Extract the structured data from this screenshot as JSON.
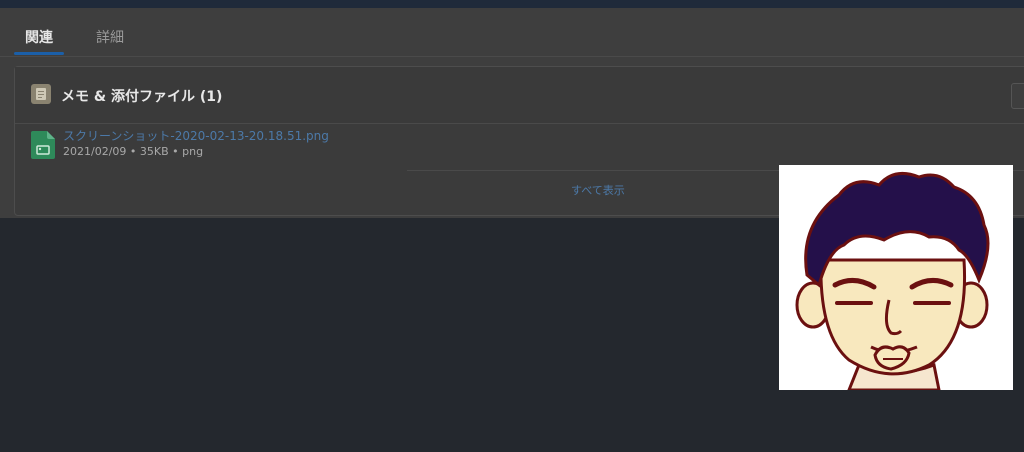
{
  "tabs": [
    {
      "label": "関連",
      "active": true
    },
    {
      "label": "詳細",
      "active": false
    }
  ],
  "related_list": {
    "title": "メモ & 添付ファイル (1)",
    "icon": "notes-icon",
    "files": [
      {
        "name": "スクリーンショット-2020-02-13-20.18.51.png",
        "meta": "2021/02/09 • 35KB • png",
        "icon": "image-file-icon"
      }
    ],
    "view_all": "すべて表示"
  },
  "avatar": {
    "icon": "cartoon-face-avatar"
  },
  "colors": {
    "background": "#24282e",
    "panel": "#3e3e3e",
    "link": "#4c79a8",
    "tab_accent": "#1b5fa8",
    "file_icon": "#2e8a5a"
  }
}
